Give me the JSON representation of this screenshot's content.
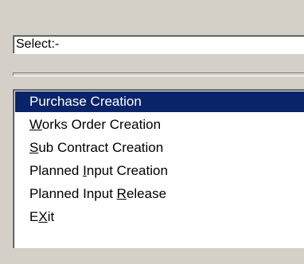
{
  "select_field": {
    "value": "Select:-"
  },
  "menu": {
    "items": [
      {
        "pre": "Purchase Creation",
        "key": "",
        "post": ""
      },
      {
        "pre": "",
        "key": "W",
        "post": "orks Order Creation"
      },
      {
        "pre": "",
        "key": "S",
        "post": "ub Contract Creation"
      },
      {
        "pre": "Planned ",
        "key": "I",
        "post": "nput Creation"
      },
      {
        "pre": "Planned Input ",
        "key": "R",
        "post": "elease"
      },
      {
        "pre": "E",
        "key": "X",
        "post": "it"
      }
    ],
    "selected_index": 0
  },
  "colors": {
    "background": "#d4d0c8",
    "selection": "#0a246a",
    "selection_text": "#ffffff"
  }
}
